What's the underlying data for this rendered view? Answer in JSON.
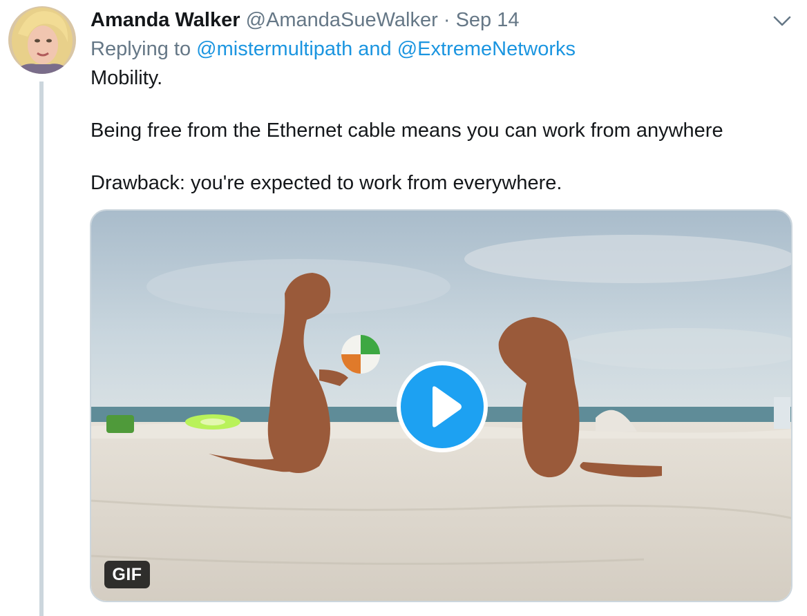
{
  "tweet": {
    "author_name": "Amanda Walker",
    "author_handle": "@AmandaSueWalker",
    "separator": "·",
    "date": "Sep 14",
    "replying_prefix": "Replying to",
    "mention_1": "@mistermultipath",
    "mention_joiner": "and",
    "mention_2": "@ExtremeNetworks",
    "text_lines": [
      "Mobility.",
      "Being free from the Ethernet cable means you can work from anywhere",
      "Drawback: you're expected to work from everywhere."
    ],
    "media": {
      "badge": "GIF",
      "play_icon": "play-icon"
    }
  },
  "icons": {
    "menu": "chevron-down-icon"
  },
  "colors": {
    "link": "#1b95e0",
    "secondary_text": "#657786",
    "play_button": "#1da1f2",
    "thread_line": "#ccd6dd"
  }
}
